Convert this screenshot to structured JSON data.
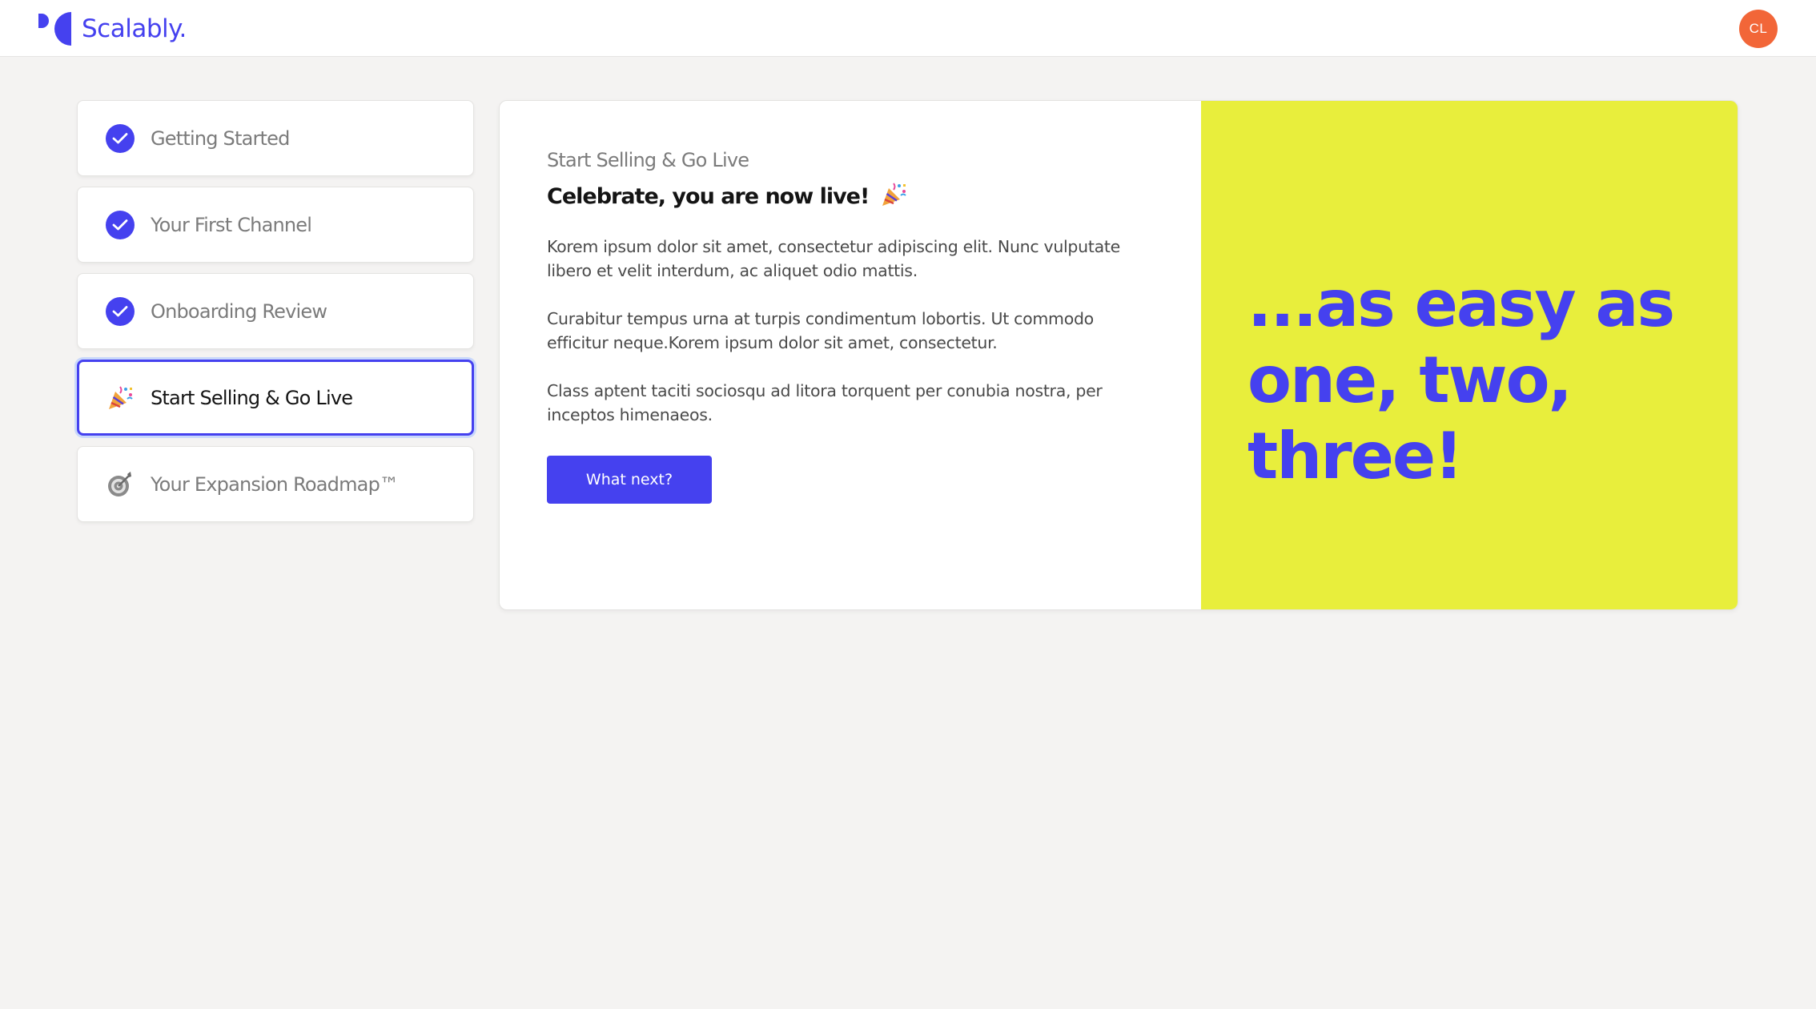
{
  "header": {
    "brand": "Scalably.",
    "avatar_initials": "CL",
    "brand_color": "#4541ef",
    "avatar_color": "#f26638"
  },
  "steps": [
    {
      "label": "Getting Started",
      "status": "complete",
      "icon": "check-circle-icon"
    },
    {
      "label": "Your First Channel",
      "status": "complete",
      "icon": "check-circle-icon"
    },
    {
      "label": "Onboarding Review",
      "status": "complete",
      "icon": "check-circle-icon"
    },
    {
      "label": "Start Selling & Go Live",
      "status": "active",
      "icon": "party-popper-icon"
    },
    {
      "label": "Your Expansion Roadmap™",
      "status": "locked",
      "icon": "target-icon"
    }
  ],
  "content": {
    "eyebrow": "Start Selling & Go Live",
    "title": "Celebrate, you are now live!",
    "paragraphs": [
      "Korem ipsum dolor sit amet, consectetur adipiscing elit. Nunc vulputate libero et velit interdum, ac aliquet odio mattis.",
      "Curabitur tempus urna at turpis condimentum lobortis. Ut commodo efficitur neque.Korem ipsum dolor sit amet, consectetur.",
      "Class aptent taciti sociosqu ad litora torquent per conubia nostra, per inceptos himenaeos."
    ],
    "button_label": "What next?"
  },
  "promo": {
    "tagline": "...as easy as one, two, three!",
    "background": "#e8ee3c"
  }
}
